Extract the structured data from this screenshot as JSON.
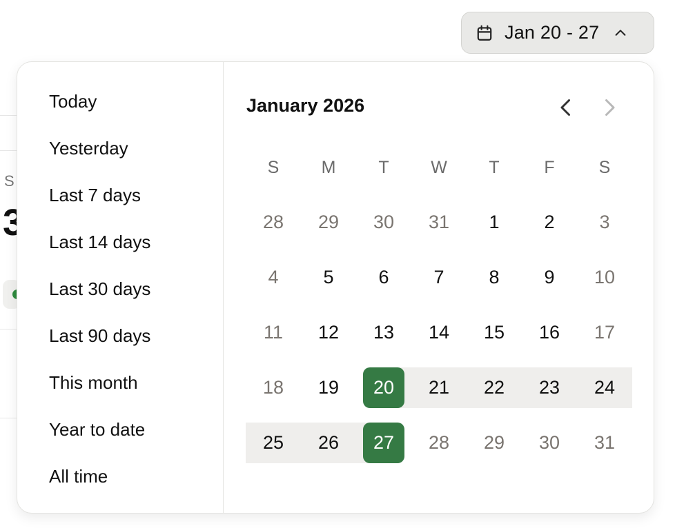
{
  "trigger": {
    "label": "Jan 20 - 27",
    "icon": "calendar-icon",
    "chevron": "chevron-up-icon"
  },
  "background": {
    "letter": "S",
    "big_number": "3"
  },
  "presets": [
    "Today",
    "Yesterday",
    "Last 7 days",
    "Last 14 days",
    "Last 30 days",
    "Last 90 days",
    "This month",
    "Year to date",
    "All time"
  ],
  "calendar": {
    "month_title": "January 2026",
    "prev_icon": "chevron-left-icon",
    "next_icon": "chevron-right-icon",
    "weekdays": [
      "S",
      "M",
      "T",
      "W",
      "T",
      "F",
      "S"
    ],
    "weeks": [
      [
        "28",
        "29",
        "30",
        "31",
        "1",
        "2",
        "3"
      ],
      [
        "4",
        "5",
        "6",
        "7",
        "8",
        "9",
        "10"
      ],
      [
        "11",
        "12",
        "13",
        "14",
        "15",
        "16",
        "17"
      ],
      [
        "18",
        "19",
        "20",
        "21",
        "22",
        "23",
        "24"
      ],
      [
        "25",
        "26",
        "27",
        "28",
        "29",
        "30",
        "31"
      ]
    ],
    "range_start": "20",
    "range_end": "27",
    "accent_color": "#357a44",
    "range_color": "#efeeec"
  }
}
